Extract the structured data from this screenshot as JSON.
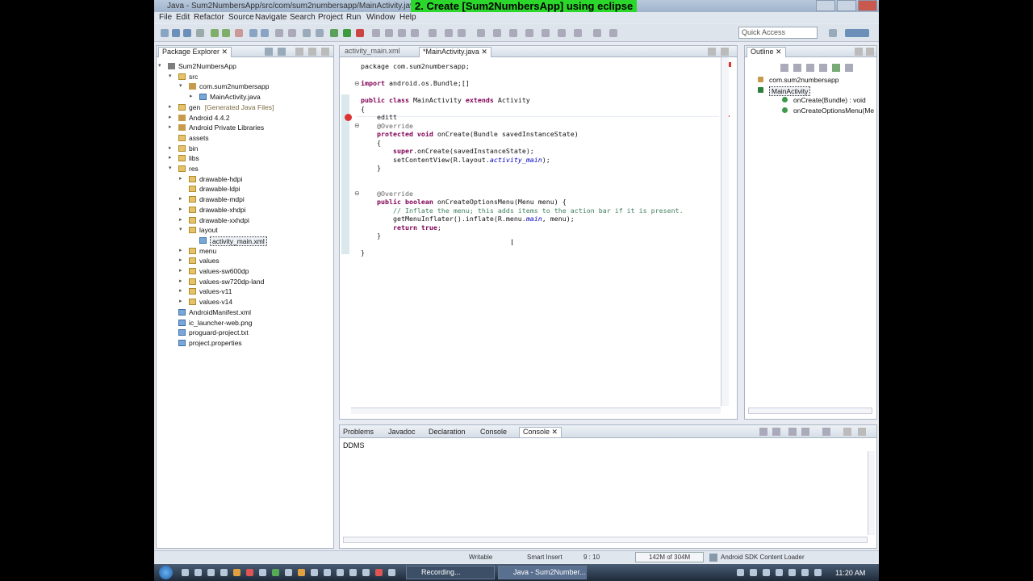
{
  "window": {
    "title": "Java - Sum2NumbersApp/src/com/sum2numbersapp/MainActivity.java - ADT"
  },
  "banner": "2. Create [Sum2NumbersApp] using eclipse",
  "menu": [
    "File",
    "Edit",
    "Refactor",
    "Source",
    "Navigate",
    "Search",
    "Project",
    "Run",
    "Window",
    "Help"
  ],
  "quick_access": "Quick Access",
  "package_explorer": {
    "tab": "Package Explorer",
    "items": [
      {
        "label": "Sum2NumbersApp",
        "indent": 0,
        "arrow": "▾",
        "icon": "proj"
      },
      {
        "label": "src",
        "indent": 1,
        "arrow": "▾",
        "icon": "fold"
      },
      {
        "label": "com.sum2numbersapp",
        "indent": 2,
        "arrow": "▾",
        "icon": "pkg"
      },
      {
        "label": "MainActivity.java",
        "indent": 3,
        "arrow": "▸",
        "icon": "jfile"
      },
      {
        "label": "gen",
        "extra": "[Generated Java Files]",
        "indent": 1,
        "arrow": "▸",
        "icon": "fold"
      },
      {
        "label": "Android 4.4.2",
        "indent": 1,
        "arrow": "▸",
        "icon": "pkg"
      },
      {
        "label": "Android Private Libraries",
        "indent": 1,
        "arrow": "▸",
        "icon": "pkg"
      },
      {
        "label": "assets",
        "indent": 1,
        "arrow": "",
        "icon": "fold"
      },
      {
        "label": "bin",
        "indent": 1,
        "arrow": "▸",
        "icon": "fold"
      },
      {
        "label": "libs",
        "indent": 1,
        "arrow": "▸",
        "icon": "fold"
      },
      {
        "label": "res",
        "indent": 1,
        "arrow": "▾",
        "icon": "fold"
      },
      {
        "label": "drawable-hdpi",
        "indent": 2,
        "arrow": "▸",
        "icon": "fold"
      },
      {
        "label": "drawable-ldpi",
        "indent": 2,
        "arrow": "",
        "icon": "fold"
      },
      {
        "label": "drawable-mdpi",
        "indent": 2,
        "arrow": "▸",
        "icon": "fold"
      },
      {
        "label": "drawable-xhdpi",
        "indent": 2,
        "arrow": "▸",
        "icon": "fold"
      },
      {
        "label": "drawable-xxhdpi",
        "indent": 2,
        "arrow": "▸",
        "icon": "fold"
      },
      {
        "label": "layout",
        "indent": 2,
        "arrow": "▾",
        "icon": "fold"
      },
      {
        "label": "activity_main.xml",
        "indent": 3,
        "arrow": "",
        "icon": "jfile",
        "selected": true
      },
      {
        "label": "menu",
        "indent": 2,
        "arrow": "▸",
        "icon": "fold"
      },
      {
        "label": "values",
        "indent": 2,
        "arrow": "▸",
        "icon": "fold"
      },
      {
        "label": "values-sw600dp",
        "indent": 2,
        "arrow": "▸",
        "icon": "fold"
      },
      {
        "label": "values-sw720dp-land",
        "indent": 2,
        "arrow": "▸",
        "icon": "fold"
      },
      {
        "label": "values-v11",
        "indent": 2,
        "arrow": "▸",
        "icon": "fold"
      },
      {
        "label": "values-v14",
        "indent": 2,
        "arrow": "▸",
        "icon": "fold"
      },
      {
        "label": "AndroidManifest.xml",
        "indent": 1,
        "arrow": "",
        "icon": "jfile"
      },
      {
        "label": "ic_launcher-web.png",
        "indent": 1,
        "arrow": "",
        "icon": "jfile"
      },
      {
        "label": "proguard-project.txt",
        "indent": 1,
        "arrow": "",
        "icon": "jfile"
      },
      {
        "label": "project.properties",
        "indent": 1,
        "arrow": "",
        "icon": "jfile"
      }
    ]
  },
  "editor": {
    "tabs": [
      "activity_main.xml",
      "*MainActivity.java"
    ],
    "lines": [
      [
        {
          "t": "package com.sum2numbersapp;"
        }
      ],
      [],
      [
        {
          "t": "import ",
          "c": "kw"
        },
        {
          "t": "android.os.Bundle;"
        },
        {
          "t": "[]"
        }
      ],
      [],
      [
        {
          "t": "public class ",
          "c": "kw"
        },
        {
          "t": "MainActivity "
        },
        {
          "t": "extends ",
          "c": "kw"
        },
        {
          "t": "Activity"
        }
      ],
      [
        {
          "t": "{"
        }
      ],
      [
        {
          "t": "    editt"
        }
      ],
      [
        {
          "t": "    @Override",
          "c": "ann"
        }
      ],
      [
        {
          "t": "    "
        },
        {
          "t": "protected void ",
          "c": "kw"
        },
        {
          "t": "onCreate(Bundle savedInstanceState)"
        }
      ],
      [
        {
          "t": "    {"
        }
      ],
      [
        {
          "t": "        "
        },
        {
          "t": "super",
          "c": "kw"
        },
        {
          "t": ".onCreate(savedInstanceState);"
        }
      ],
      [
        {
          "t": "        setContentView(R.layout."
        },
        {
          "t": "activity_main",
          "c": "it"
        },
        {
          "t": ");"
        }
      ],
      [
        {
          "t": "    }"
        }
      ],
      [],
      [],
      [
        {
          "t": "    @Override",
          "c": "ann"
        }
      ],
      [
        {
          "t": "    "
        },
        {
          "t": "public boolean ",
          "c": "kw"
        },
        {
          "t": "onCreateOptionsMenu(Menu menu) {"
        }
      ],
      [
        {
          "t": "        // Inflate the menu; this adds items to the action bar if it is present.",
          "c": "cm"
        }
      ],
      [
        {
          "t": "        getMenuInflater().inflate(R.menu."
        },
        {
          "t": "main",
          "c": "it"
        },
        {
          "t": ", menu);"
        }
      ],
      [
        {
          "t": "        "
        },
        {
          "t": "return true",
          "c": "kw"
        },
        {
          "t": ";"
        }
      ],
      [
        {
          "t": "    }"
        }
      ],
      [],
      [
        {
          "t": "}"
        }
      ]
    ]
  },
  "outline": {
    "tab": "Outline",
    "items": [
      {
        "label": "com.sum2numbersapp",
        "indent": 1
      },
      {
        "label": "MainActivity",
        "indent": 1,
        "selected": true
      },
      {
        "label": "onCreate(Bundle) : void",
        "indent": 2
      },
      {
        "label": "onCreateOptionsMenu(Me",
        "indent": 2
      }
    ]
  },
  "bottom": {
    "tabs": [
      "Problems",
      "Javadoc",
      "Declaration",
      "Console",
      "Console"
    ],
    "console_label": "DDMS"
  },
  "status": {
    "writable": "Writable",
    "insert": "Smart Insert",
    "position": "9 : 10",
    "memory": "142M of 304M",
    "task": "Android SDK Content Loader"
  },
  "taskbar": {
    "items": [
      "Recording...",
      "Java - Sum2Number..."
    ],
    "clock": "11:20 AM"
  }
}
